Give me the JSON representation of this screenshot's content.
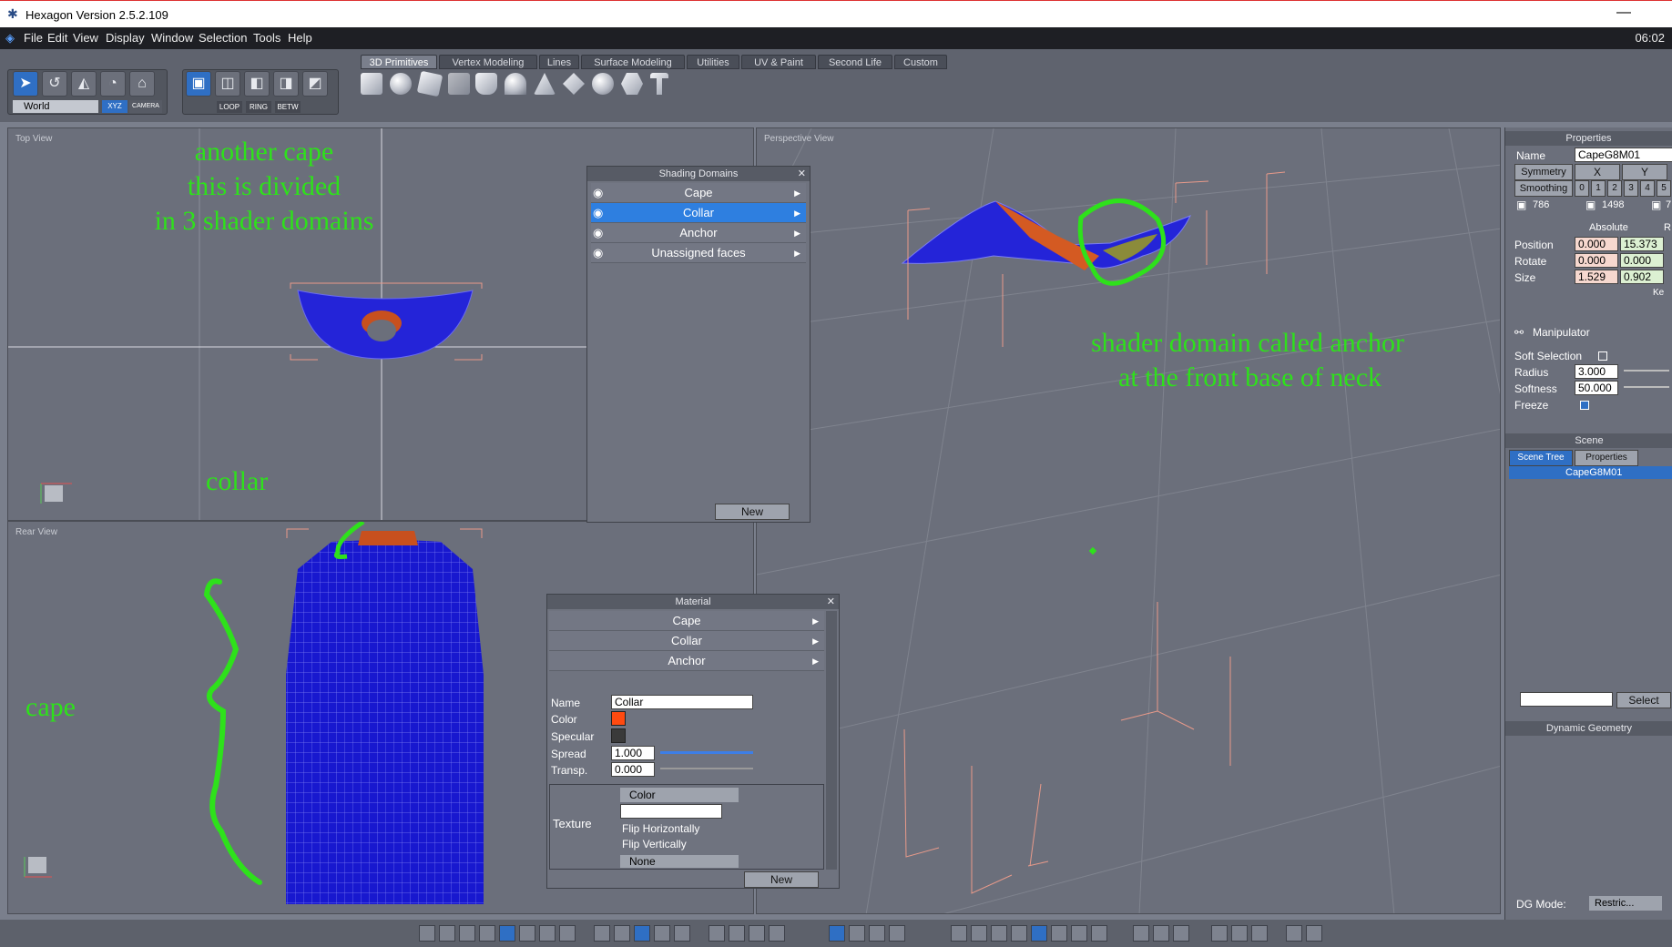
{
  "window": {
    "title": "Hexagon Version 2.5.2.109",
    "clock": "06:02"
  },
  "menu": [
    "File",
    "Edit",
    "View",
    "Display",
    "Window",
    "Selection",
    "Tools",
    "Help"
  ],
  "tabs": [
    "3D Primitives",
    "Vertex Modeling",
    "Lines",
    "Surface Modeling",
    "Utilities",
    "UV & Paint",
    "Second Life",
    "Custom"
  ],
  "toolbar": {
    "coord": "World",
    "xyz": "XYZ",
    "camera": "CAMERA",
    "loop": "LOOP",
    "ring": "RING",
    "betw": "BETW"
  },
  "viewports": {
    "top": "Top View",
    "rear": "Rear View",
    "perspective": "Perspective View"
  },
  "annotations": {
    "cape_line1": "another cape",
    "cape_line2": "this is divided",
    "cape_line3": "in 3 shader domains",
    "collar": "collar",
    "cape": "cape",
    "anchor_line1": "shader domain called anchor",
    "anchor_line2": "at the front base of neck"
  },
  "shading_domains": {
    "title": "Shading Domains",
    "items": [
      "Cape",
      "Collar",
      "Anchor",
      "Unassigned faces"
    ],
    "new": "New"
  },
  "material": {
    "title": "Material",
    "items": [
      "Cape",
      "Collar",
      "Anchor"
    ],
    "name_label": "Name",
    "name_value": "Collar",
    "color_label": "Color",
    "specular_label": "Specular",
    "spread_label": "Spread",
    "spread_value": "1.000",
    "transp_label": "Transp.",
    "transp_value": "0.000",
    "texture_label": "Texture",
    "texture_type": "Color",
    "flip_h": "Flip Horizontally",
    "flip_v": "Flip Vertically",
    "none": "None",
    "new": "New",
    "color_hex": "#ff4a10",
    "specular_hex": "#3a3a3a"
  },
  "properties": {
    "title": "Properties",
    "name_label": "Name",
    "name_value": "CapeG8M01",
    "symmetry": "Symmetry",
    "sym_x": "X",
    "sym_y": "Y",
    "smoothing": "Smoothing",
    "smooth_levels": [
      "0",
      "1",
      "2",
      "3",
      "4",
      "5"
    ],
    "count1": "786",
    "count2": "1498",
    "count3": "7",
    "absolute": "Absolute",
    "relative": "R",
    "position_label": "Position",
    "position": [
      "0.000",
      "15.373"
    ],
    "rotate_label": "Rotate",
    "rotate": [
      "0.000",
      "0.000"
    ],
    "size_label": "Size",
    "size": [
      "1.529",
      "0.902"
    ],
    "keep": "Ke",
    "manipulator": "Manipulator",
    "soft_selection": "Soft Selection",
    "radius_label": "Radius",
    "radius": "3.000",
    "softness_label": "Softness",
    "softness": "50.000",
    "freeze": "Freeze"
  },
  "scene": {
    "title": "Scene",
    "tab_tree": "Scene Tree",
    "tab_props": "Properties",
    "item": "CapeG8M01",
    "select": "Select",
    "dynamic_geometry": "Dynamic Geometry",
    "dg_mode_label": "DG Mode:",
    "dg_mode_value": "Restric..."
  }
}
